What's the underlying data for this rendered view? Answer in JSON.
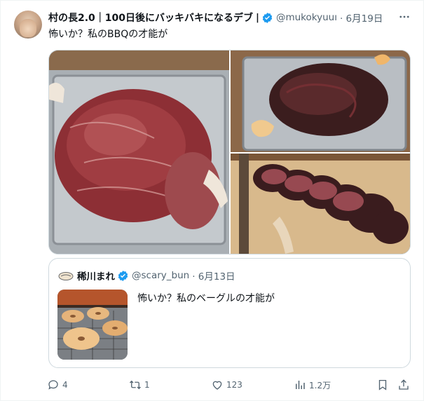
{
  "author": {
    "name": "村の長2.0｜100日後にバッキバキになるデブ",
    "separator": "|",
    "handle": "@mukokyuuı",
    "time": "· 6月19日"
  },
  "tweet": {
    "text": "怖いか？私のBBQの才能が"
  },
  "icons": [
    "verified-icon",
    "more-icon",
    "reply-icon",
    "retweet-icon",
    "like-icon",
    "views-icon",
    "bookmark-icon",
    "share-icon"
  ],
  "colors": {
    "verified": "#1d9bf0",
    "secondary_text": "#536471",
    "border": "#cfd9de"
  },
  "quote": {
    "name": "稀川まれ",
    "handle": "@scary_bun",
    "time": "· 6月13日",
    "text": "怖いか？私のベーグルの才能が"
  },
  "actions": {
    "replies": "4",
    "retweets": "1",
    "likes": "123",
    "views": "1.2万"
  }
}
